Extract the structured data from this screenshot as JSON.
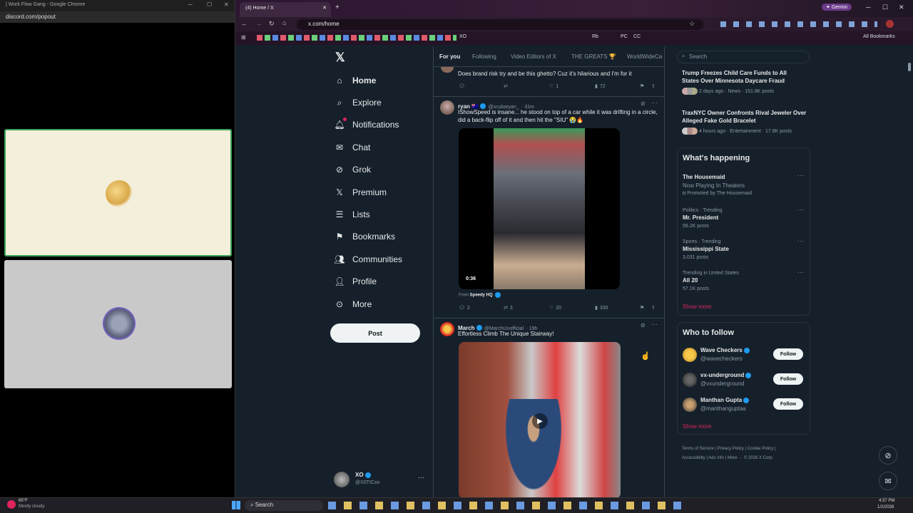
{
  "discord_window": {
    "title": "| Work Flow Gang - Google Chrome",
    "url": "discord.com/popout"
  },
  "browser": {
    "tab_title": "(4) Home / X",
    "url": "x.com/home",
    "gemini_label": "Gemini",
    "all_bookmarks": "All Bookmarks",
    "bookmark_xo": "XO",
    "bookmark_rb": "Rb",
    "bookmark_pc": "PC",
    "bookmark_cc": "CC"
  },
  "nav": {
    "items": [
      {
        "label": "Home",
        "icon": "home-icon"
      },
      {
        "label": "Explore",
        "icon": "search-icon"
      },
      {
        "label": "Notifications",
        "icon": "bell-icon"
      },
      {
        "label": "Chat",
        "icon": "mail-icon"
      },
      {
        "label": "Grok",
        "icon": "grok-icon"
      },
      {
        "label": "Premium",
        "icon": "x-logo-icon"
      },
      {
        "label": "Lists",
        "icon": "list-icon"
      },
      {
        "label": "Bookmarks",
        "icon": "bookmark-icon"
      },
      {
        "label": "Communities",
        "icon": "people-icon"
      },
      {
        "label": "Profile",
        "icon": "person-icon"
      },
      {
        "label": "More",
        "icon": "more-circle-icon"
      }
    ],
    "post_label": "Post",
    "account": {
      "name": "XO",
      "handle": "@X0TICxo"
    }
  },
  "feed_tabs": [
    "For you",
    "Following",
    "Video Editors of X",
    "THE GREATS 🏆",
    "WorldWideCa"
  ],
  "tweets": [
    {
      "text": "Does brand risk try and be this ghetto? Cuz it's hilarious and I'm for it",
      "likes": "1",
      "views": "72"
    },
    {
      "name": "ryan 🇦🇺",
      "handle": "@scubaryan_",
      "time": "· 31m",
      "text": "IShowSpeed is insane... he stood on top of a car while it was drifting in a circle, did a back-flip off of it and then hit the \"SIU\" 😭🔥",
      "video_time": "0:36",
      "from_prefix": "From",
      "from_name": "Speedy HQ",
      "replies": "2",
      "reposts": "3",
      "likes": "20",
      "views": "330"
    },
    {
      "name": "March",
      "handle": "@MarchUnofficial",
      "time": "· 19h",
      "text": "Effortless Climb The Unique Stairway!"
    }
  ],
  "right": {
    "search_placeholder": "Search",
    "top_news": [
      {
        "title": "Trump Freezes Child Care Funds to All States Over Minnesota Daycare Fraud",
        "meta": "2 days ago · News · 151.8K posts"
      },
      {
        "title": "TraxNYC Owner Confronts Rival Jeweler Over Alleged Fake Gold Bracelet",
        "meta": "4 hours ago · Entertainment · 17.8K posts"
      }
    ],
    "happening_title": "What's happening",
    "trends": [
      {
        "title": "The Housemaid",
        "sub": "Now Playing In Theaters",
        "extra": "Promoted by The Housemaid"
      },
      {
        "context": "Politics · Trending",
        "title": "Mr. President",
        "posts": "56.2K posts"
      },
      {
        "context": "Sports · Trending",
        "title": "Mississippi State",
        "posts": "3,031 posts"
      },
      {
        "context": "Trending in United States",
        "title": "All 20",
        "posts": "57.1K posts"
      }
    ],
    "show_more": "Show more",
    "who_to_follow_title": "Who to follow",
    "follow_suggestions": [
      {
        "name": "Wave Checkers",
        "handle": "@wavecheckers"
      },
      {
        "name": "vx-underground",
        "handle": "@vxunderground"
      },
      {
        "name": "Manthan Gupta",
        "handle": "@manthanguptaa"
      }
    ],
    "follow_label": "Follow",
    "footer": [
      "Terms of Service",
      "Privacy Policy",
      "Cookie Policy",
      "Accessibility",
      "Ads info",
      "More ···",
      "© 2026 X Corp."
    ]
  },
  "taskbar": {
    "weather_temp": "65°F",
    "weather_desc": "Mostly cloudy",
    "search_label": "Search",
    "time": "4:37 PM",
    "date": "1/2/2026"
  },
  "colors": {
    "x_bg": "#15202b",
    "accent_pink": "#e0245e",
    "verified_blue": "#1d9bf0"
  }
}
